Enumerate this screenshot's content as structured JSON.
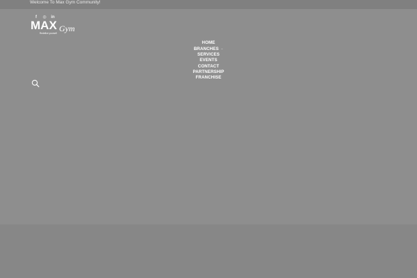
{
  "topbar": {
    "welcome_text": "Welcome To Max Gym Community!"
  },
  "social": [
    {
      "name": "facebook-icon",
      "glyph": "f"
    },
    {
      "name": "instagram-icon",
      "glyph": "◎"
    },
    {
      "name": "linkedin-icon",
      "glyph": "in"
    }
  ],
  "logo": {
    "word_max": "MAX",
    "word_gym": "Gym",
    "tagline": "Redefine yourself"
  },
  "nav": {
    "items": [
      {
        "label": "HOME"
      },
      {
        "label": "BRANCHES",
        "has_dropdown": true,
        "caret": "⌄"
      },
      {
        "label": "SERVICES"
      },
      {
        "label": "EVENTS"
      },
      {
        "label": "CONTACT"
      },
      {
        "label": "PARTNERSHIP"
      },
      {
        "label": "FRANCHISE"
      }
    ]
  },
  "search": {
    "icon": "search-icon"
  },
  "colors": {
    "page_bg": "#8f8f8f",
    "topbar_bg": "#808080",
    "footer_bg": "#878787",
    "text": "#ffffff"
  }
}
